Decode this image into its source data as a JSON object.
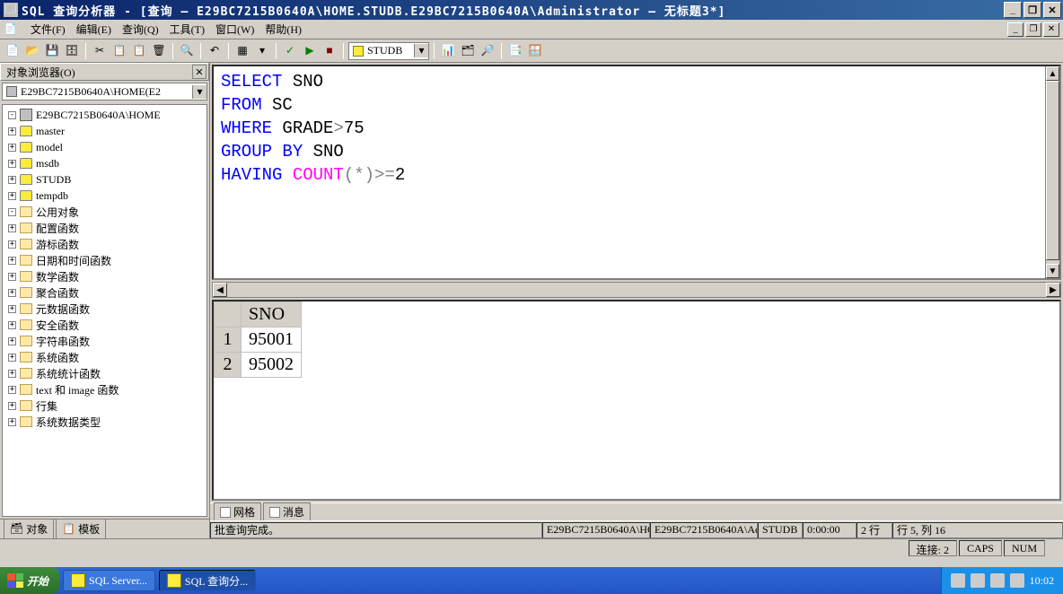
{
  "titlebar": {
    "text": "SQL 查询分析器 - [查询 — E29BC7215B0640A\\HOME.STUDB.E29BC7215B0640A\\Administrator — 无标题3*]"
  },
  "menu": {
    "items": [
      "文件(F)",
      "编辑(E)",
      "查询(Q)",
      "工具(T)",
      "窗口(W)",
      "帮助(H)"
    ]
  },
  "toolbar": {
    "db_combo": "STUDB"
  },
  "object_browser": {
    "title": "对象浏览器(O)",
    "combo": "E29BC7215B0640A\\HOME(E2",
    "root": "E29BC7215B0640A\\HOME",
    "databases": [
      "master",
      "model",
      "msdb",
      "STUDB",
      "tempdb"
    ],
    "common_label": "公用对象",
    "folders": [
      "配置函数",
      "游标函数",
      "日期和时间函数",
      "数学函数",
      "聚合函数",
      "元数据函数",
      "安全函数",
      "字符串函数",
      "系统函数",
      "系统统计函数",
      "text 和 image 函数",
      "行集",
      "系统数据类型"
    ],
    "tabs": {
      "objects": "对象",
      "templates": "模板"
    }
  },
  "query": {
    "tokens": [
      {
        "t": "SELECT",
        "c": "kw-blue"
      },
      {
        "t": " SNO\n",
        "c": ""
      },
      {
        "t": "FROM",
        "c": "kw-blue"
      },
      {
        "t": " SC\n",
        "c": ""
      },
      {
        "t": "WHERE",
        "c": "kw-blue"
      },
      {
        "t": " GRADE",
        "c": ""
      },
      {
        "t": ">",
        "c": "kw-gray"
      },
      {
        "t": "75\n",
        "c": ""
      },
      {
        "t": "GROUP BY",
        "c": "kw-blue"
      },
      {
        "t": " SNO\n",
        "c": ""
      },
      {
        "t": "HAVING",
        "c": "kw-blue"
      },
      {
        "t": " ",
        "c": ""
      },
      {
        "t": "COUNT",
        "c": "kw-magenta"
      },
      {
        "t": "(*)>=",
        "c": "kw-gray"
      },
      {
        "t": "2",
        "c": ""
      }
    ]
  },
  "results": {
    "columns": [
      "SNO"
    ],
    "rows": [
      [
        "95001"
      ],
      [
        "95002"
      ]
    ]
  },
  "result_tabs": {
    "grid": "网格",
    "message": "消息"
  },
  "status": {
    "msg": "批查询完成。",
    "server": "E29BC7215B0640A\\HO",
    "user": "E29BC7215B0640A\\Ad",
    "db": "STUDB",
    "time": "0:00:00",
    "rows": "2 行",
    "pos": "行 5, 列 16"
  },
  "status2": {
    "conn": "连接: 2",
    "caps": "CAPS",
    "num": "NUM"
  },
  "taskbar": {
    "start": "开始",
    "tasks": [
      "SQL Server...",
      "SQL 查询分..."
    ],
    "clock": "10:02"
  }
}
